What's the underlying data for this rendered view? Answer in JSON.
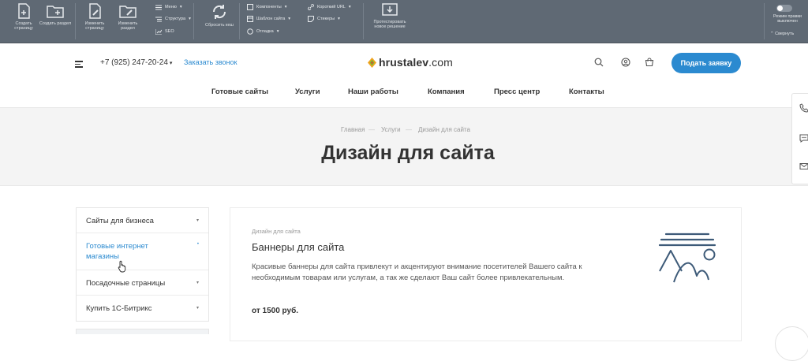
{
  "admin": {
    "create_page": "Создать страницу",
    "create_section": "Создать раздел",
    "edit_page": "Изменить страницу",
    "edit_section": "Изменить раздел",
    "menu": "Меню",
    "structure": "Структура",
    "seo": "SEO",
    "reset_cache": "Сбросить кеш",
    "components": "Компоненты",
    "site_template": "Шаблон сайта",
    "debug": "Отладка",
    "short_url": "Короткий URL",
    "stickers": "Стикеры",
    "test_solution": "Протестировать новое решение",
    "rights_mode": "Режим правки выключен",
    "collapse": "Свернуть"
  },
  "header": {
    "phone": "+7 (925) 247-20-24",
    "phone_caret": "▾",
    "callback": "Заказать звонок",
    "logo_bold": "hrustalev",
    "logo_rest": ".com",
    "cta": "Подать заявку"
  },
  "nav": [
    "Готовые сайты",
    "Услуги",
    "Наши работы",
    "Компания",
    "Пресс центр",
    "Контакты"
  ],
  "breadcrumbs": [
    "Главная",
    "Услуги",
    "Дизайн для сайта"
  ],
  "breadcrumb_sep": "—",
  "page_title": "Дизайн для сайта",
  "sidebar": [
    {
      "label": "Сайты для бизнеса",
      "arrow": "▾"
    },
    {
      "label": "Готовые интернет магазины",
      "arrow": "•"
    },
    {
      "label": "Посадочные страницы",
      "arrow": "▾"
    },
    {
      "label": "Купить 1С-Битрикс",
      "arrow": "▾"
    }
  ],
  "card": {
    "category": "Дизайн для сайта",
    "title": "Баннеры для сайта",
    "text": "Красивые баннеры для сайта привлекут и акцентируют внимание посетителей Вашего сайта к необходимым товарам или услугам, а так же сделают Ваш сайт более привлекательным.",
    "price": "от 1500 руб."
  },
  "icons": {
    "burger": "menu-icon",
    "search": "search-icon",
    "profile": "user-icon",
    "cart": "cart-icon",
    "phone": "phone-icon",
    "chat": "chat-icon",
    "mail": "mail-icon",
    "illustration": "image-landscape-icon"
  },
  "colors": {
    "accent": "#2b8ad0",
    "admin_bg": "#5f6974",
    "band_bg": "#f4f4f4",
    "illustration": "#3d5a78"
  }
}
